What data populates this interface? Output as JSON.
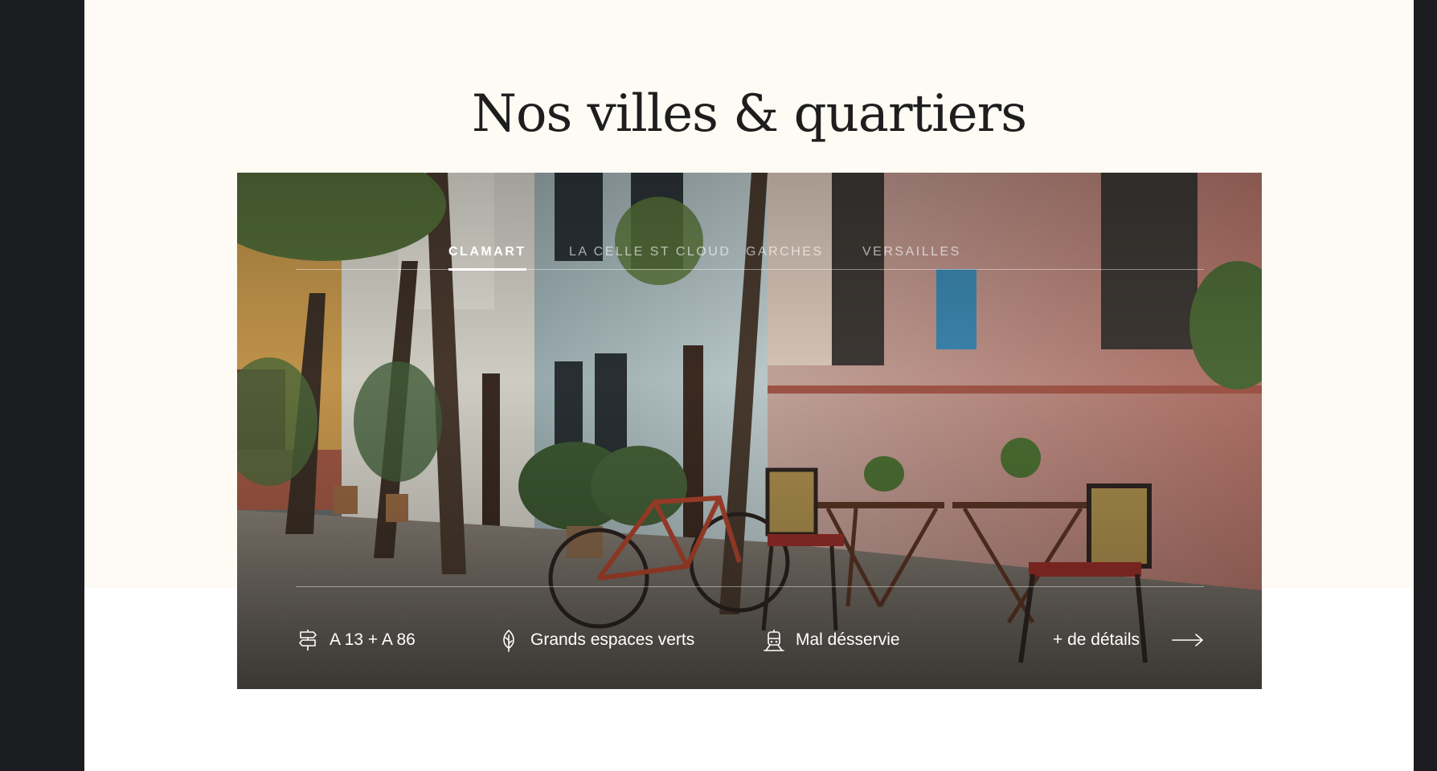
{
  "section": {
    "title": "Nos villes & quartiers"
  },
  "tabs": [
    {
      "label": "CLAMART",
      "active": true
    },
    {
      "label": "LA CELLE ST CLOUD",
      "active": false
    },
    {
      "label": "GARCHES",
      "active": false
    },
    {
      "label": "VERSAILLES",
      "active": false
    }
  ],
  "features": [
    {
      "icon": "signpost-icon",
      "label": "A 13 + A 86"
    },
    {
      "icon": "leaf-icon",
      "label": "Grands espaces verts"
    },
    {
      "icon": "train-icon",
      "label": "Mal désservie"
    }
  ],
  "details_link": {
    "label": "+ de détails",
    "icon": "arrow-right-icon"
  },
  "colors": {
    "page_background": "#1b1d20",
    "cream_band": "#fdfbf4",
    "title_text": "#1e1e1e",
    "overlay_text": "#ffffff"
  }
}
